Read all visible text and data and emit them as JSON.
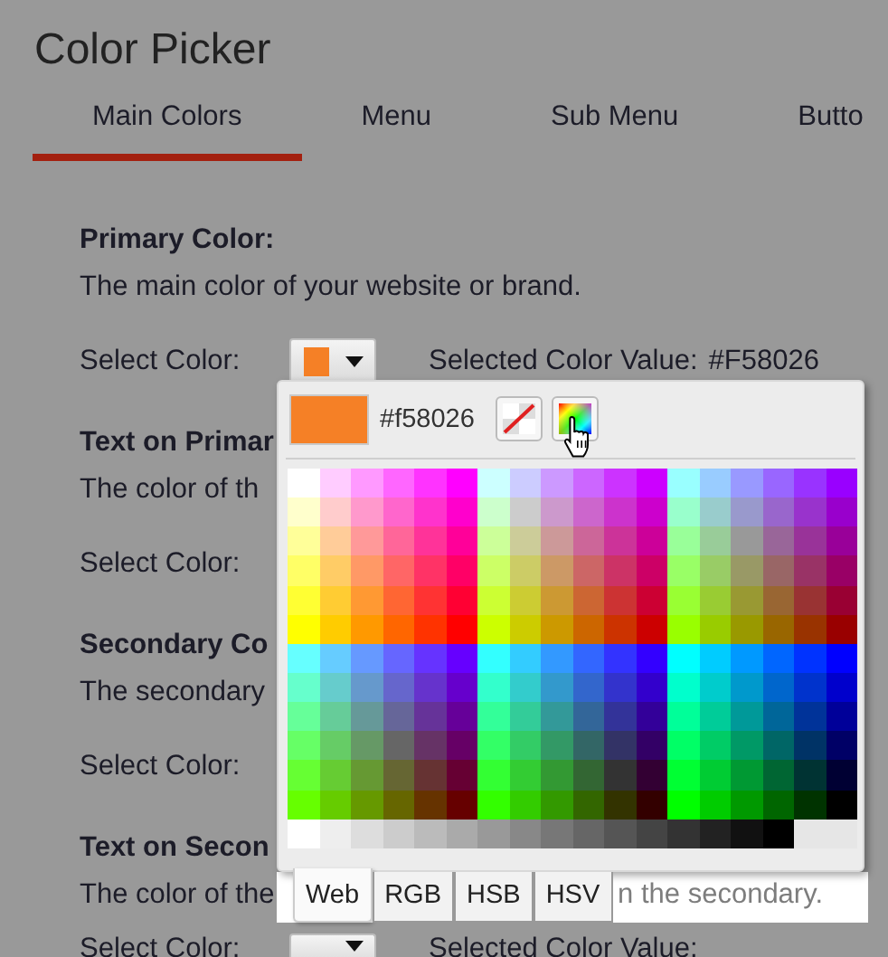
{
  "title": "Color Picker",
  "tabs": [
    {
      "label": "Main Colors",
      "selected": true
    },
    {
      "label": "Menu",
      "selected": false
    },
    {
      "label": "Sub Menu",
      "selected": false
    },
    {
      "label": "Butto",
      "selected": false
    }
  ],
  "sections": [
    {
      "heading": "Primary Color:",
      "description": "The main color of your website or brand.",
      "select_label": "Select Color:",
      "color": "#f58026",
      "value_label": "Selected Color Value:",
      "value": "#F58026"
    },
    {
      "heading": "Text on Primar",
      "description": "The color of th",
      "select_label": "Select Color:"
    },
    {
      "heading": "Secondary Co",
      "description": "The secondary",
      "select_label": "Select Color:"
    },
    {
      "heading": "Text on Secon",
      "description": "The color of the",
      "description_end": "n the secondary.",
      "select_label": "Select Color:",
      "value_label": "Selected Color Value:"
    }
  ],
  "picker": {
    "color": "#f58026",
    "hex": "#f58026",
    "tabs": [
      {
        "label": "Web",
        "selected": true
      },
      {
        "label": "RGB",
        "selected": false
      },
      {
        "label": "HSB",
        "selected": false
      },
      {
        "label": "HSV",
        "selected": false
      }
    ]
  }
}
